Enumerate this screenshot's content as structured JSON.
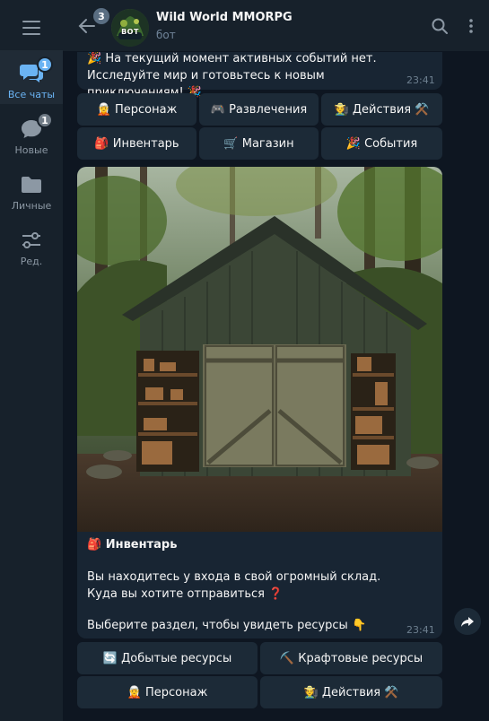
{
  "sidebar": {
    "folders": [
      {
        "label": "Все чаты",
        "badge": "1",
        "icon": "chats-icon"
      },
      {
        "label": "Новые",
        "badge": "1",
        "icon": "chat-bubble-icon"
      },
      {
        "label": "Личные",
        "badge": "",
        "icon": "folder-icon"
      },
      {
        "label": "Ред.",
        "badge": "",
        "icon": "edit-sliders-icon"
      }
    ]
  },
  "header": {
    "back_badge": "3",
    "avatar_text": "BOT",
    "title": "Wild World MMORPG",
    "subtitle": "бот"
  },
  "prev_message": {
    "text": "🎉 На текущий момент активных событий нет. Исследуйте мир и готовьтесь к новым приключениям! 🎉",
    "time": "23:41"
  },
  "keyboard_top": [
    [
      "🧝 Персонаж",
      "🎮 Развлечения",
      "🧑‍🌾 Действия ⚒️"
    ],
    [
      "🎒 Инвентарь",
      "🛒 Магазин",
      "🎉 События"
    ]
  ],
  "photo_message": {
    "heading": "🎒 Инвентарь",
    "line1": "Вы находитесь у входа в свой огромный склад.",
    "line2": "Куда вы хотите отправиться ❓",
    "line3": "Выберите раздел, чтобы увидеть ресурсы 👇",
    "time": "23:41"
  },
  "keyboard_bottom": [
    [
      "🔄 Добытые ресурсы",
      "⛏️ Крафтовые ресурсы"
    ],
    [
      "🧝 Персонаж",
      "🧑‍🌾 Действия ⚒️"
    ]
  ],
  "colors": {
    "background": "#0e1621",
    "panel": "#17212b",
    "bubble": "#182533",
    "accent": "#6ab3f3"
  }
}
